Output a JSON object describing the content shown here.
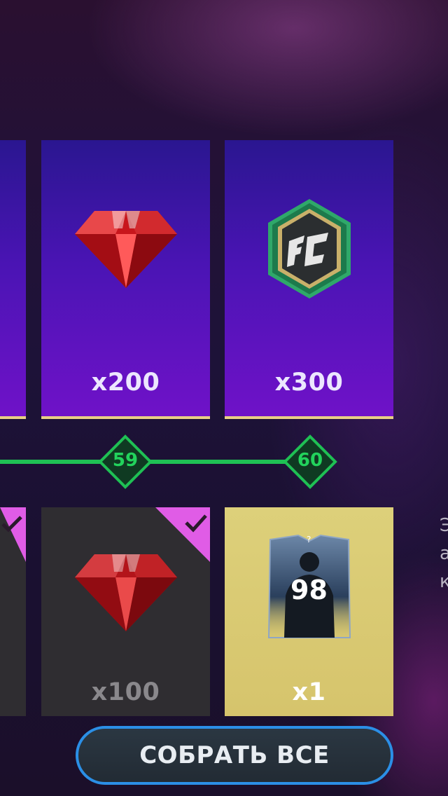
{
  "track": {
    "milestones": [
      {
        "level": "59"
      },
      {
        "level": "60"
      }
    ]
  },
  "top_rewards": [
    {
      "item": "partial-card",
      "quantity": ""
    },
    {
      "item": "gem-icon",
      "quantity": "x200"
    },
    {
      "item": "fc-points-icon",
      "quantity": "x300"
    }
  ],
  "bottom_rewards": [
    {
      "item": "partial-card",
      "quantity": "",
      "claimed": true
    },
    {
      "item": "gem-icon",
      "quantity": "x100",
      "claimed": true
    },
    {
      "item": "player-card-icon",
      "quantity": "x1",
      "rating": "98",
      "claimed": false
    }
  ],
  "side_panel": {
    "lines": [
      "Э",
      "а",
      "к"
    ]
  },
  "buttons": {
    "collect_all": "СОБРАТЬ ВСЕ"
  },
  "colors": {
    "track_green": "#1fc054",
    "card_purple": "#5a14c0",
    "claimed_pink": "#e05ce6",
    "gold_card": "#d9ca72",
    "button_border": "#2b8fe6"
  }
}
